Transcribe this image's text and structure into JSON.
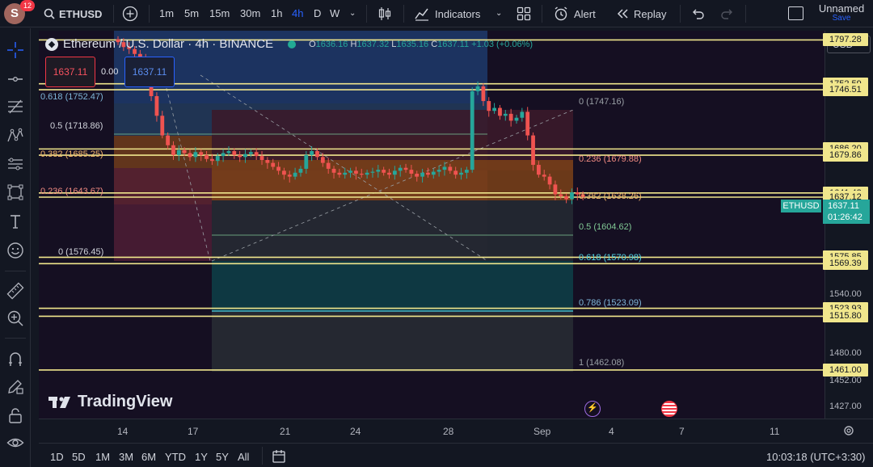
{
  "topbar": {
    "avatar_letter": "S",
    "notif_count": "12",
    "symbol": "ETHUSD",
    "intervals": [
      "1m",
      "5m",
      "15m",
      "30m",
      "1h",
      "4h",
      "D",
      "W"
    ],
    "active_interval": "4h",
    "indicators_label": "Indicators",
    "alert_label": "Alert",
    "replay_label": "Replay",
    "layout_name": "Unnamed",
    "save_label": "Save"
  },
  "legend": {
    "title": "Ethereum / U.S. Dollar · 4h · BINANCE",
    "o_label": "O",
    "o_value": "1636.16",
    "h_label": "H",
    "h_value": "1637.32",
    "l_label": "L",
    "l_value": "1635.16",
    "c_label": "C",
    "c_value": "1637.11",
    "change": "+1.03 (+0.06%)"
  },
  "trade_panel": {
    "sell_price": "1637.11",
    "spread": "0.00",
    "buy_price": "1637.11"
  },
  "currency": "USD",
  "price_tag": {
    "symbol": "ETHUSD",
    "price": "1637.11",
    "countdown": "01:26:42"
  },
  "fib_left": [
    {
      "text": "0.618 (1752.47)",
      "color": "#7fb6d9"
    },
    {
      "text": "0.5 (1718.86)",
      "color": "#d1d4dc"
    },
    {
      "text": "0.382 (1685.25)",
      "color": "#f5b56b"
    },
    {
      "text": "0.236 (1643.67)",
      "color": "#f28b82"
    },
    {
      "text": "0 (1576.45)",
      "color": "#d1d4dc"
    }
  ],
  "fib_right": [
    {
      "text": "0 (1747.16)",
      "color": "#9aa0a6"
    },
    {
      "text": "0.236 (1679.88)",
      "color": "#f28b82"
    },
    {
      "text": "0.382 (1638.26)",
      "color": "#f5b56b"
    },
    {
      "text": "0.5 (1604.62)",
      "color": "#81c995"
    },
    {
      "text": "0.618 (1570.98)",
      "color": "#4dd0e1"
    },
    {
      "text": "0.786 (1523.09)",
      "color": "#7fb6d9"
    },
    {
      "text": "1 (1462.08)",
      "color": "#9aa0a6"
    }
  ],
  "hline_tags": [
    "1797.28",
    "1752.59",
    "1746.51",
    "1686.20",
    "1679.86",
    "1641.42",
    "1637.12",
    "1575.85",
    "1569.39",
    "1523.93",
    "1515.80",
    "1461.00"
  ],
  "y_axis_labels": [
    "1540.00",
    "1480.00",
    "1452.00",
    "1427.00"
  ],
  "x_axis_labels": [
    "14",
    "17",
    "21",
    "24",
    "28",
    "Sep",
    "4",
    "7",
    "11"
  ],
  "logo_text": "TradingView",
  "bottombar": {
    "ranges": [
      "1D",
      "5D",
      "1M",
      "3M",
      "6M",
      "YTD",
      "1Y",
      "5Y",
      "All"
    ],
    "clock": "10:03:18 (UTC+3:30)"
  },
  "colors": {
    "bg": "#131722",
    "accent": "#2962ff",
    "hline": "#f0e68c",
    "price": "#26a69a"
  }
}
